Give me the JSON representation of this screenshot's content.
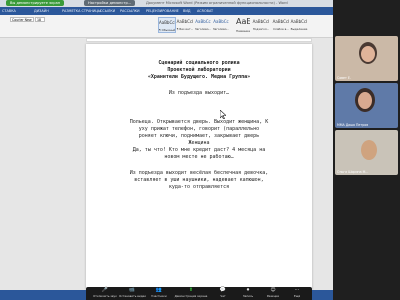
{
  "window": {
    "share_indicator": "Вы демонстрируете экран",
    "settings_indicator": "Настройки демонстр...",
    "doc_title": "Документ Microsoft Word (Режим ограниченной функциональности) - Word"
  },
  "ribbon": {
    "tabs": [
      "СТАВКА",
      "ДИЗАЙН",
      "РАЗМЕТКА СТРАНИЦЫ",
      "ССЫЛКИ",
      "РАССЫЛКИ",
      "РЕЦЕНЗИРОВАНИЕ",
      "ВИД",
      "ACROBAT"
    ],
    "font": "Courier New",
    "size": "18",
    "styles": [
      {
        "sample": "AaBbCcI",
        "name": "¶ Обычный"
      },
      {
        "sample": "AaBbCcI",
        "name": "¶ Без инт..."
      },
      {
        "sample": "AaBbCc",
        "name": "Заголово..."
      },
      {
        "sample": "AaBbCc",
        "name": "Заголово..."
      },
      {
        "sample": "АаБ",
        "name": "Название"
      },
      {
        "sample": "AaBbCcI",
        "name": "Подзагол..."
      },
      {
        "sample": "AaBbCcI",
        "name": "Слабое в..."
      },
      {
        "sample": "AaBbCcI",
        "name": "Выделение"
      }
    ]
  },
  "document": {
    "title_lines": [
      "Сценарий социального ролика",
      "Проектной лаборатории",
      "«Хранители Будущего. Медиа Группа»"
    ],
    "body_lines": [
      "Из подъезда выходит…",
      "",
      "",
      "Польеца. Открывается дверь. Выходит женщина, К",
      "уху прижат телефон, говорит (параллельно",
      "роняет ключи, поднимает, закрывает дверь",
      "Женщина",
      "Да, ты что! Кто мне кредит даст? 4 месяца на",
      "новом месте не работаю…",
      "",
      "Из подъезда выходит весёлая беспечная девочка,",
      "вставляет в уши наушники, надевает капюшон,",
      "куда-то отправляется"
    ]
  },
  "participants": [
    {
      "name": "Совет Е."
    },
    {
      "name": "ММА Даша Петров"
    },
    {
      "name": "Ольга Шорина М..."
    },
    {
      "name": ""
    }
  ],
  "zoom_toolbar": {
    "buttons": [
      {
        "icon": "🎤",
        "label": "Отключить звук"
      },
      {
        "icon": "📹",
        "label": "Остановить видео"
      },
      {
        "icon": "👥",
        "label": "Участники"
      },
      {
        "icon": "⬆",
        "label": "Демонстрация экрана"
      },
      {
        "icon": "💬",
        "label": "Чат"
      },
      {
        "icon": "⏺",
        "label": "Запись"
      },
      {
        "icon": "😊",
        "label": "Реакции"
      },
      {
        "icon": "⋯",
        "label": "Ещё"
      }
    ]
  }
}
